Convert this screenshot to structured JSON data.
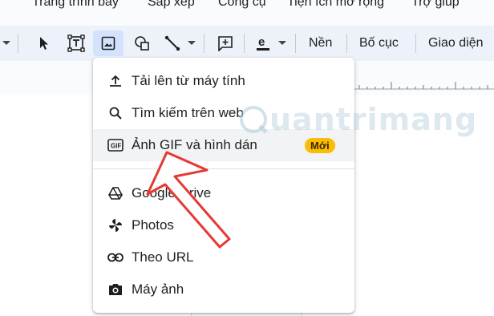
{
  "menubar": {
    "items": [
      "Trang trình bày",
      "Sắp xếp",
      "Công cụ",
      "Tiện ích mở rộng",
      "Trợ giúp"
    ]
  },
  "toolbar": {
    "bg_label": "Nền",
    "layout_label": "Bố cục",
    "theme_label": "Giao diện"
  },
  "image_menu": {
    "items": [
      {
        "label": "Tải lên từ máy tính",
        "icon": "upload-icon"
      },
      {
        "label": "Tìm kiếm trên web",
        "icon": "search-icon"
      },
      {
        "label": "Ảnh GIF và hình dán",
        "icon": "gif-icon",
        "badge": "Mới",
        "highlighted": true
      },
      {
        "label": "Google Drive",
        "icon": "google-drive-icon"
      },
      {
        "label": "Photos",
        "icon": "photos-pinwheel-icon"
      },
      {
        "label": "Theo URL",
        "icon": "link-icon"
      },
      {
        "label": "Máy ảnh",
        "icon": "camera-icon"
      }
    ]
  },
  "watermark": "uantrimang",
  "colors": {
    "badge": "#fbbc04",
    "arrow": "#e53935",
    "toolbar_bg": "#edf2fa",
    "active_tool": "#d3e3fd"
  }
}
